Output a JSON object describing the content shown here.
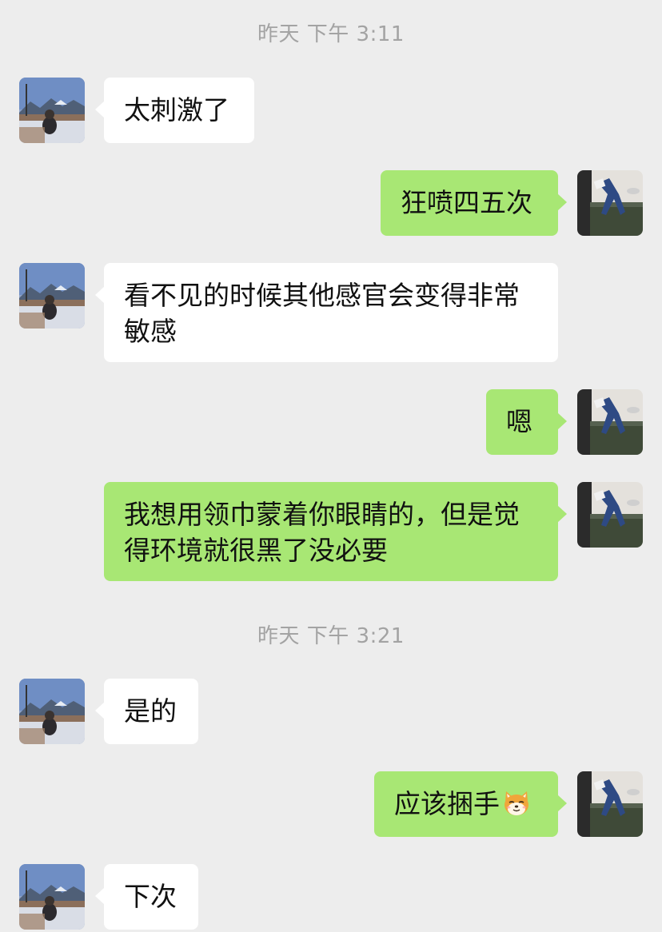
{
  "colors": {
    "background": "#ededed",
    "incoming_bubble": "#ffffff",
    "outgoing_bubble": "#a8e774",
    "timestamp_text": "#a3a3a3",
    "message_text": "#111111"
  },
  "timestamps": [
    "昨天 下午 3:11",
    "昨天 下午 3:21"
  ],
  "messages": [
    {
      "side": "left",
      "text": "太刺激了"
    },
    {
      "side": "right",
      "text": "狂喷四五次"
    },
    {
      "side": "left",
      "text": "看不见的时候其他感官会变得非常敏感"
    },
    {
      "side": "right",
      "text": "嗯"
    },
    {
      "side": "right",
      "text": "我想用领巾蒙着你眼睛的，但是觉得环境就很黑了没必要"
    },
    {
      "side": "left",
      "text": "是的"
    },
    {
      "side": "right",
      "text": "应该捆手",
      "emoji": "doge-cat-emoji"
    },
    {
      "side": "left",
      "text": "下次"
    }
  ],
  "avatars": {
    "left": "contact-avatar",
    "right": "self-avatar"
  }
}
